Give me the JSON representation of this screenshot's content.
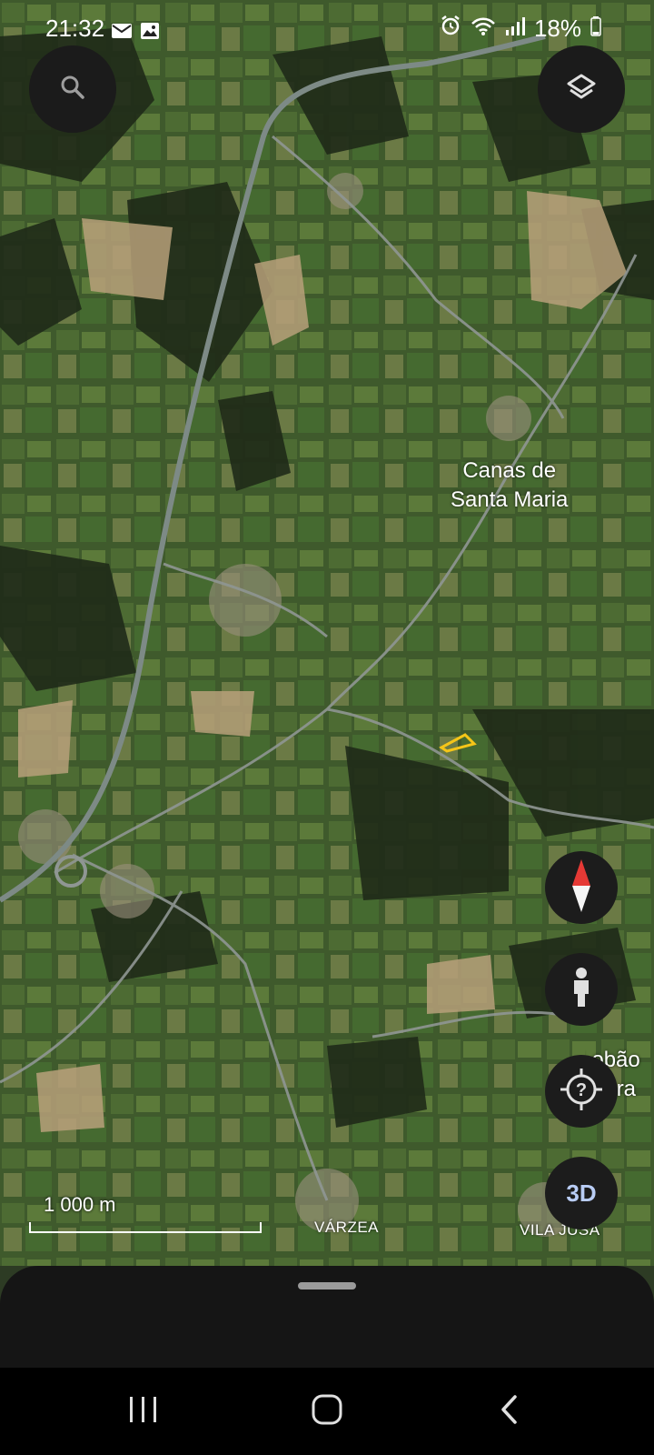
{
  "status_bar": {
    "time": "21:32",
    "battery": "18%",
    "left_icons": [
      "mail-icon",
      "image-icon"
    ],
    "right_icons": [
      "alarm-icon",
      "wifi-icon",
      "signal-icon",
      "battery-icon"
    ]
  },
  "map": {
    "places": {
      "canas": "Canas de\nSanta Maria",
      "lobao": "Lobão\nBeira",
      "varzea": "VÁRZEA",
      "vila_jusa": "VILA JUSÃ"
    },
    "scale_label": "1 000 m"
  },
  "controls": {
    "search": "search-icon",
    "layers": "layers-icon",
    "compass": "compass-icon",
    "street_view": "pegman-icon",
    "my_location": "my-location-icon",
    "three_d": "3D"
  },
  "colors": {
    "control_bg": "#1b1b1b",
    "compass_red": "#e53935",
    "three_d_text": "#b9cdf5",
    "parcel_outline": "#f5c518"
  },
  "nav_bar": [
    "recents-icon",
    "home-icon",
    "back-icon"
  ]
}
